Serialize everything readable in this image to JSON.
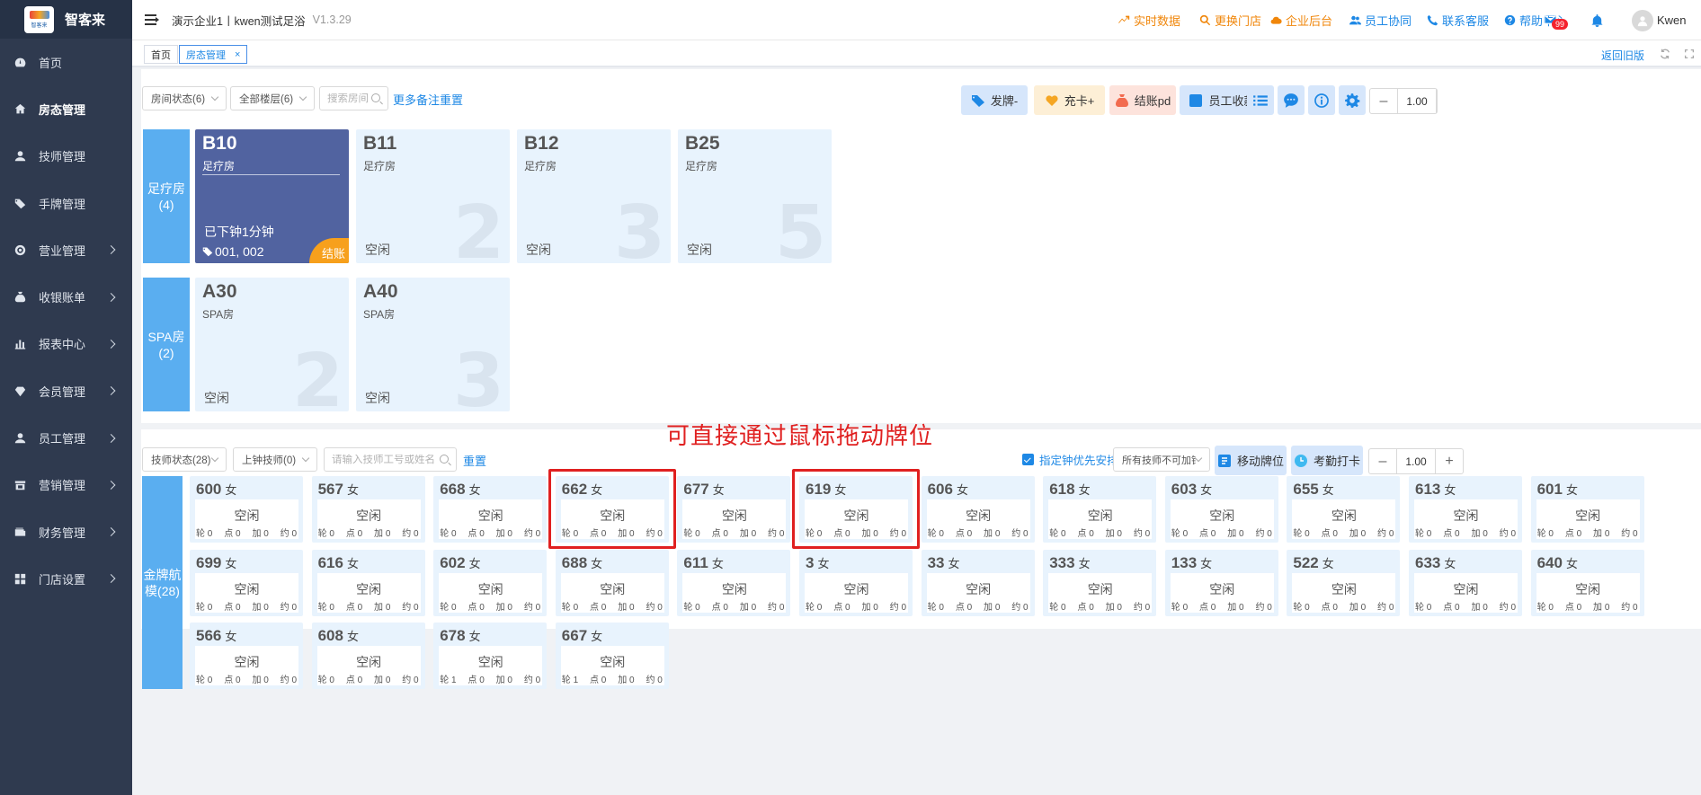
{
  "app": {
    "logo_text": "智客来",
    "logo_subtext": "智客来"
  },
  "sidebar": {
    "items": [
      {
        "label": "首页",
        "icon": "dashboard-icon",
        "has_arrow": false
      },
      {
        "label": "房态管理",
        "icon": "home-icon",
        "has_arrow": false,
        "active": true
      },
      {
        "label": "技师管理",
        "icon": "user-icon",
        "has_arrow": false
      },
      {
        "label": "手牌管理",
        "icon": "tag-icon",
        "has_arrow": false
      },
      {
        "label": "营业管理",
        "icon": "target-icon",
        "has_arrow": true
      },
      {
        "label": "收银账单",
        "icon": "money-bag-icon",
        "has_arrow": true
      },
      {
        "label": "报表中心",
        "icon": "bar-chart-icon",
        "has_arrow": true
      },
      {
        "label": "会员管理",
        "icon": "diamond-icon",
        "has_arrow": true
      },
      {
        "label": "员工管理",
        "icon": "user-icon",
        "has_arrow": true
      },
      {
        "label": "营销管理",
        "icon": "store-icon",
        "has_arrow": true
      },
      {
        "label": "财务管理",
        "icon": "wallet-icon",
        "has_arrow": true
      },
      {
        "label": "门店设置",
        "icon": "grid-icon",
        "has_arrow": true
      }
    ]
  },
  "header": {
    "breadcrumb": "演示企业1丨kwen测试足浴",
    "version": "V1.3.29",
    "links": [
      {
        "label": "实时数据",
        "color": "orange",
        "icon": "trend-icon"
      },
      {
        "label": "更换门店",
        "color": "orange",
        "icon": "search-icon"
      },
      {
        "label": "企业后台",
        "color": "orange",
        "icon": "cloud-icon"
      },
      {
        "label": "员工协同",
        "color": "blue",
        "icon": "users-icon"
      },
      {
        "label": "联系客服",
        "color": "blue",
        "icon": "phone-icon"
      },
      {
        "label": "帮助中心",
        "color": "blue",
        "icon": "help-icon"
      }
    ],
    "mail_badge": "99",
    "user_name": "Kwen"
  },
  "tabs": {
    "items": [
      "首页",
      "房态管理"
    ],
    "back_label": "返回旧版"
  },
  "rooms_toolbar": {
    "room_status": "房间状态(6)",
    "floor": "全部楼层(6)",
    "search_placeholder": "搜索房间",
    "more": "更多",
    "note": "备注",
    "reset": "重置",
    "actions": [
      {
        "label": "发牌-",
        "bg": "#d6e6fb",
        "color": "#333",
        "icon": "tag-icon"
      },
      {
        "label": "充卡+",
        "bg": "#fdefd6",
        "color": "#333",
        "icon": "heart-icon"
      },
      {
        "label": "结账pd",
        "bg": "#fde3dc",
        "color": "#333",
        "icon": "money-bag-icon"
      },
      {
        "label": "员工收款",
        "bg": "#d6e6fb",
        "color": "#333",
        "icon": "cash-icon"
      }
    ],
    "zoom": "1.00"
  },
  "room_groups": [
    {
      "label": "足疗房",
      "count": "(4)",
      "rooms": [
        {
          "number": "B10",
          "type": "足疗房",
          "status": "已下钟1分钟",
          "tags": "001, 002",
          "badge": "结账",
          "busy": true
        },
        {
          "number": "B11",
          "type": "足疗房",
          "status": "空闲",
          "capacity": "2"
        },
        {
          "number": "B12",
          "type": "足疗房",
          "status": "空闲",
          "capacity": "3"
        },
        {
          "number": "B25",
          "type": "足疗房",
          "status": "空闲",
          "capacity": "5"
        }
      ]
    },
    {
      "label": "SPA房",
      "count": "(2)",
      "rooms": [
        {
          "number": "A30",
          "type": "SPA房",
          "status": "空闲",
          "capacity": "2"
        },
        {
          "number": "A40",
          "type": "SPA房",
          "status": "空闲",
          "capacity": "3"
        }
      ]
    }
  ],
  "tech_toolbar": {
    "tech_status": "技师状态(28)",
    "clock_status": "上钟技师(0)",
    "search_placeholder": "请输入技师工号或姓名",
    "reset": "重置",
    "priority_label": "指定钟优先安排",
    "add_clock": "所有技师不可加钟",
    "move_label": "移动牌位",
    "attendance_label": "考勤打卡",
    "zoom": "1.00"
  },
  "annotation": "可直接通过鼠标拖动牌位",
  "tech_group": {
    "label": "金牌航模",
    "count": "(28)"
  },
  "counter_labels": [
    "轮",
    "点",
    "加",
    "约"
  ],
  "techs": [
    {
      "id": "600",
      "gender": "女",
      "status": "空闲",
      "counts": [
        0,
        0,
        0,
        0
      ]
    },
    {
      "id": "567",
      "gender": "女",
      "status": "空闲",
      "counts": [
        0,
        0,
        0,
        0
      ]
    },
    {
      "id": "668",
      "gender": "女",
      "status": "空闲",
      "counts": [
        0,
        0,
        0,
        0
      ]
    },
    {
      "id": "662",
      "gender": "女",
      "status": "空闲",
      "counts": [
        0,
        0,
        0,
        0
      ],
      "highlight": true
    },
    {
      "id": "677",
      "gender": "女",
      "status": "空闲",
      "counts": [
        0,
        0,
        0,
        0
      ]
    },
    {
      "id": "619",
      "gender": "女",
      "status": "空闲",
      "counts": [
        0,
        0,
        0,
        0
      ],
      "highlight": true
    },
    {
      "id": "606",
      "gender": "女",
      "status": "空闲",
      "counts": [
        0,
        0,
        0,
        0
      ]
    },
    {
      "id": "618",
      "gender": "女",
      "status": "空闲",
      "counts": [
        0,
        0,
        0,
        0
      ]
    },
    {
      "id": "603",
      "gender": "女",
      "status": "空闲",
      "counts": [
        0,
        0,
        0,
        0
      ]
    },
    {
      "id": "655",
      "gender": "女",
      "status": "空闲",
      "counts": [
        0,
        0,
        0,
        0
      ]
    },
    {
      "id": "613",
      "gender": "女",
      "status": "空闲",
      "counts": [
        0,
        0,
        0,
        0
      ]
    },
    {
      "id": "601",
      "gender": "女",
      "status": "空闲",
      "counts": [
        0,
        0,
        0,
        0
      ]
    },
    {
      "id": "699",
      "gender": "女",
      "status": "空闲",
      "counts": [
        0,
        0,
        0,
        0
      ]
    },
    {
      "id": "616",
      "gender": "女",
      "status": "空闲",
      "counts": [
        0,
        0,
        0,
        0
      ]
    },
    {
      "id": "602",
      "gender": "女",
      "status": "空闲",
      "counts": [
        0,
        0,
        0,
        0
      ]
    },
    {
      "id": "688",
      "gender": "女",
      "status": "空闲",
      "counts": [
        0,
        0,
        0,
        0
      ]
    },
    {
      "id": "611",
      "gender": "女",
      "status": "空闲",
      "counts": [
        0,
        0,
        0,
        0
      ]
    },
    {
      "id": "3",
      "gender": "女",
      "status": "空闲",
      "counts": [
        0,
        0,
        0,
        0
      ]
    },
    {
      "id": "33",
      "gender": "女",
      "status": "空闲",
      "counts": [
        0,
        0,
        0,
        0
      ]
    },
    {
      "id": "333",
      "gender": "女",
      "status": "空闲",
      "counts": [
        0,
        0,
        0,
        0
      ]
    },
    {
      "id": "133",
      "gender": "女",
      "status": "空闲",
      "counts": [
        0,
        0,
        0,
        0
      ]
    },
    {
      "id": "522",
      "gender": "女",
      "status": "空闲",
      "counts": [
        0,
        0,
        0,
        0
      ]
    },
    {
      "id": "633",
      "gender": "女",
      "status": "空闲",
      "counts": [
        0,
        0,
        0,
        0
      ]
    },
    {
      "id": "640",
      "gender": "女",
      "status": "空闲",
      "counts": [
        0,
        0,
        0,
        0
      ]
    },
    {
      "id": "566",
      "gender": "女",
      "status": "空闲",
      "counts": [
        0,
        0,
        0,
        0
      ]
    },
    {
      "id": "608",
      "gender": "女",
      "status": "空闲",
      "counts": [
        0,
        0,
        0,
        0
      ]
    },
    {
      "id": "678",
      "gender": "女",
      "status": "空闲",
      "counts": [
        1,
        0,
        0,
        0
      ]
    },
    {
      "id": "667",
      "gender": "女",
      "status": "空闲",
      "counts": [
        1,
        0,
        0,
        0
      ]
    }
  ]
}
